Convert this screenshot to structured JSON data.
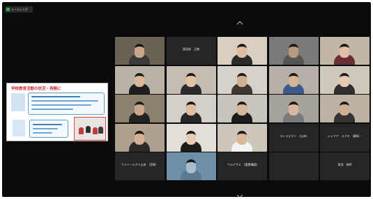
{
  "status_badge": {
    "label": "ミーティング",
    "color": "#3aa655"
  },
  "share_panel": {
    "title": "学校教育活動の状況・再開に",
    "accent": "#d12a2a"
  },
  "icons": [
    "chevron-up-icon",
    "chevron-down-icon",
    "shield-icon"
  ],
  "participants": [
    {
      "name": "",
      "video": true,
      "bg": "#6a6254",
      "skin": "#c9a58a",
      "shirt": "#3a3a3a"
    },
    {
      "name": "東田部　正樹",
      "video": false,
      "bg": "#262626"
    },
    {
      "name": "",
      "video": true,
      "bg": "#d8cfc2",
      "skin": "#e0bda0",
      "shirt": "#2a2a2a",
      "active": true
    },
    {
      "name": "",
      "video": true,
      "bg": "#7a7a78",
      "skin": "#b59a82",
      "shirt": "#555"
    },
    {
      "name": "",
      "video": true,
      "bg": "#c2b6a6",
      "skin": "#e2c0a8",
      "shirt": "#6b2f36"
    },
    {
      "name": "",
      "video": true,
      "bg": "#bab2a6",
      "skin": "#d9b79a",
      "shirt": "#1f1f1f"
    },
    {
      "name": "",
      "video": true,
      "bg": "#c4bcb2",
      "skin": "#e4c2a6",
      "shirt": "#2b2b2b"
    },
    {
      "name": "",
      "video": true,
      "bg": "#d6d2ca",
      "skin": "#d2b092",
      "shirt": "#403632"
    },
    {
      "name": "",
      "video": true,
      "bg": "#b8b0a8",
      "skin": "#d6b496",
      "shirt": "#3b5a8a"
    },
    {
      "name": "",
      "video": true,
      "bg": "#cfc8bd",
      "skin": "#e6cbb4",
      "shirt": "#2f2f2f"
    },
    {
      "name": "",
      "video": true,
      "bg": "#8c8270",
      "skin": "#c9a88c",
      "shirt": "#222"
    },
    {
      "name": "",
      "video": true,
      "bg": "#d4cfc8",
      "skin": "#e0be9f",
      "shirt": "#262626"
    },
    {
      "name": "",
      "video": true,
      "bg": "#c9c4bc",
      "skin": "#d8b699",
      "shirt": "#1c1c1c"
    },
    {
      "name": "",
      "video": true,
      "bg": "#a7a29b",
      "skin": "#d6b8a0",
      "shirt": "#7a7a7a"
    },
    {
      "name": "",
      "video": true,
      "bg": "#bdb3a4",
      "skin": "#cfae92",
      "shirt": "#333"
    },
    {
      "name": "",
      "video": true,
      "bg": "#aea190",
      "skin": "#d4b194",
      "shirt": "#2b2b2b"
    },
    {
      "name": "",
      "video": true,
      "bg": "#e2dfd8",
      "skin": "#e8cbb3",
      "shirt": "#1d1d1d"
    },
    {
      "name": "",
      "video": true,
      "bg": "#cdc6ba",
      "skin": "#dab999",
      "shirt": "#f2f2f2"
    },
    {
      "name": "ストラビデン　(山本)",
      "video": false,
      "bg": "#262626"
    },
    {
      "name": "シャアア　ユアキ　(静岡・",
      "video": false,
      "bg": "#262626"
    },
    {
      "name": "ウメトールアミ山本　(宮崎・",
      "video": false,
      "bg": "#262626"
    },
    {
      "name": "",
      "video": true,
      "bg": "#6f8fa6",
      "skin": "#a7c0d0",
      "shirt": "#5b7a90"
    },
    {
      "name": "ウルデサエ　(富豊構図)",
      "video": false,
      "bg": "#262626"
    },
    {
      "name": "",
      "video": false,
      "bg": "#262626"
    },
    {
      "name": "菊池　伸四",
      "video": false,
      "bg": "#262626"
    }
  ]
}
